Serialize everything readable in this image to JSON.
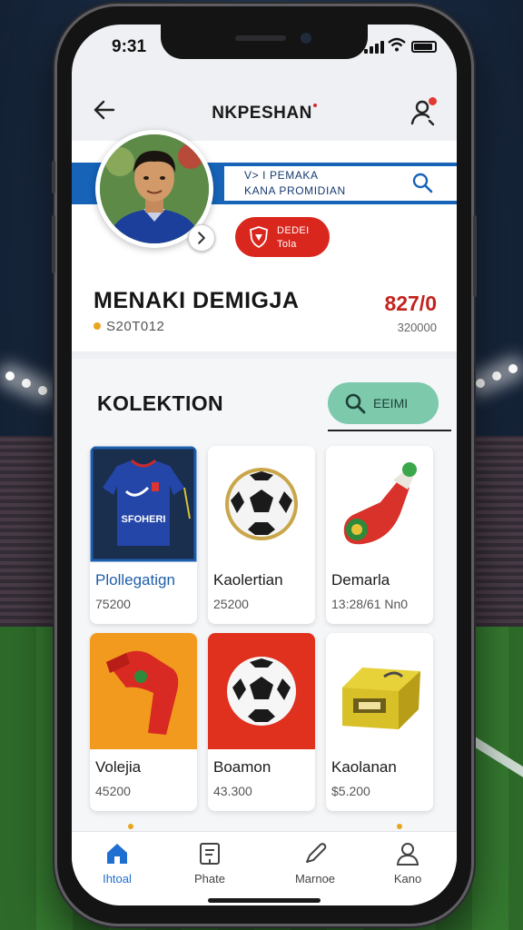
{
  "status_bar": {
    "time": "9:31"
  },
  "header": {
    "title": "NKPESHAN"
  },
  "profile": {
    "banner_line1": "V> I PEMAKA",
    "banner_line2": "KANA PROMIDIAN",
    "badge_line1": "DEDEI",
    "badge_line2": "Tola",
    "name": "MENAKI DEMIGJA",
    "user_id": "S20T012",
    "points": "827/0",
    "points_sub": "320000"
  },
  "collection": {
    "title": "KOLEKTION",
    "search_label": "EEIMI",
    "items": [
      {
        "name": "Plollegatign",
        "price": "75200",
        "icon": "jersey-image"
      },
      {
        "name": "Kaolertian",
        "price": "25200",
        "icon": "football-image"
      },
      {
        "name": "Demarla",
        "price": "13:28/61 Nn0",
        "icon": "boot-image"
      },
      {
        "name": "Volejia",
        "price": "45200",
        "icon": "sock-image"
      },
      {
        "name": "Boamon",
        "price": "43.300",
        "icon": "football-image"
      },
      {
        "name": "Kaolanan",
        "price": "$5.200",
        "icon": "wallet-image"
      }
    ]
  },
  "bottom_nav": [
    {
      "label": "Ihtoal",
      "icon": "home-icon",
      "active": true
    },
    {
      "label": "Phate",
      "icon": "book-icon",
      "active": false
    },
    {
      "label": "Marnoe",
      "icon": "pen-icon",
      "active": false
    },
    {
      "label": "Kano",
      "icon": "user-icon",
      "active": false
    }
  ],
  "colors": {
    "accent_blue": "#1663b8",
    "accent_red": "#d9271e",
    "accent_green": "#7cc9ac",
    "nav_active": "#1f6fd1"
  }
}
